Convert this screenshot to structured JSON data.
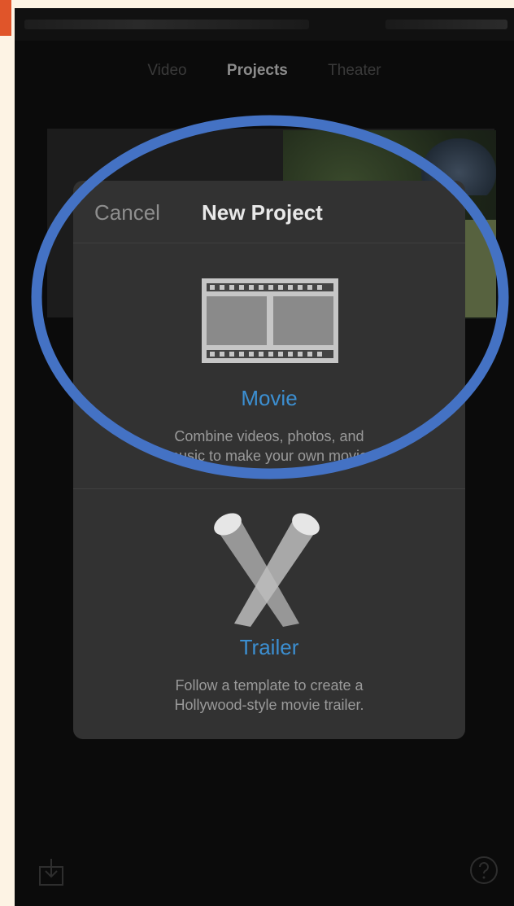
{
  "tabs": [
    {
      "label": "Video",
      "active": false
    },
    {
      "label": "Projects",
      "active": true
    },
    {
      "label": "Theater",
      "active": false
    }
  ],
  "sheet": {
    "cancel_label": "Cancel",
    "title": "New Project",
    "options": [
      {
        "id": "movie",
        "icon": "film-strip-icon",
        "title": "Movie",
        "description_line1": "Combine videos, photos, and",
        "description_line2": "music to make your own movie."
      },
      {
        "id": "trailer",
        "icon": "spotlights-icon",
        "title": "Trailer",
        "description_line1": "Follow a template to create a",
        "description_line2": "Hollywood-style movie trailer."
      }
    ]
  },
  "toolbar": {
    "import_icon": "import-icon",
    "help_icon": "help-icon"
  },
  "annotation": {
    "shape": "ellipse",
    "color": "#4472c4"
  },
  "colors": {
    "accent": "#3c8fd1",
    "sheet_bg": "#323232",
    "screen_bg": "#0b0b0b"
  }
}
